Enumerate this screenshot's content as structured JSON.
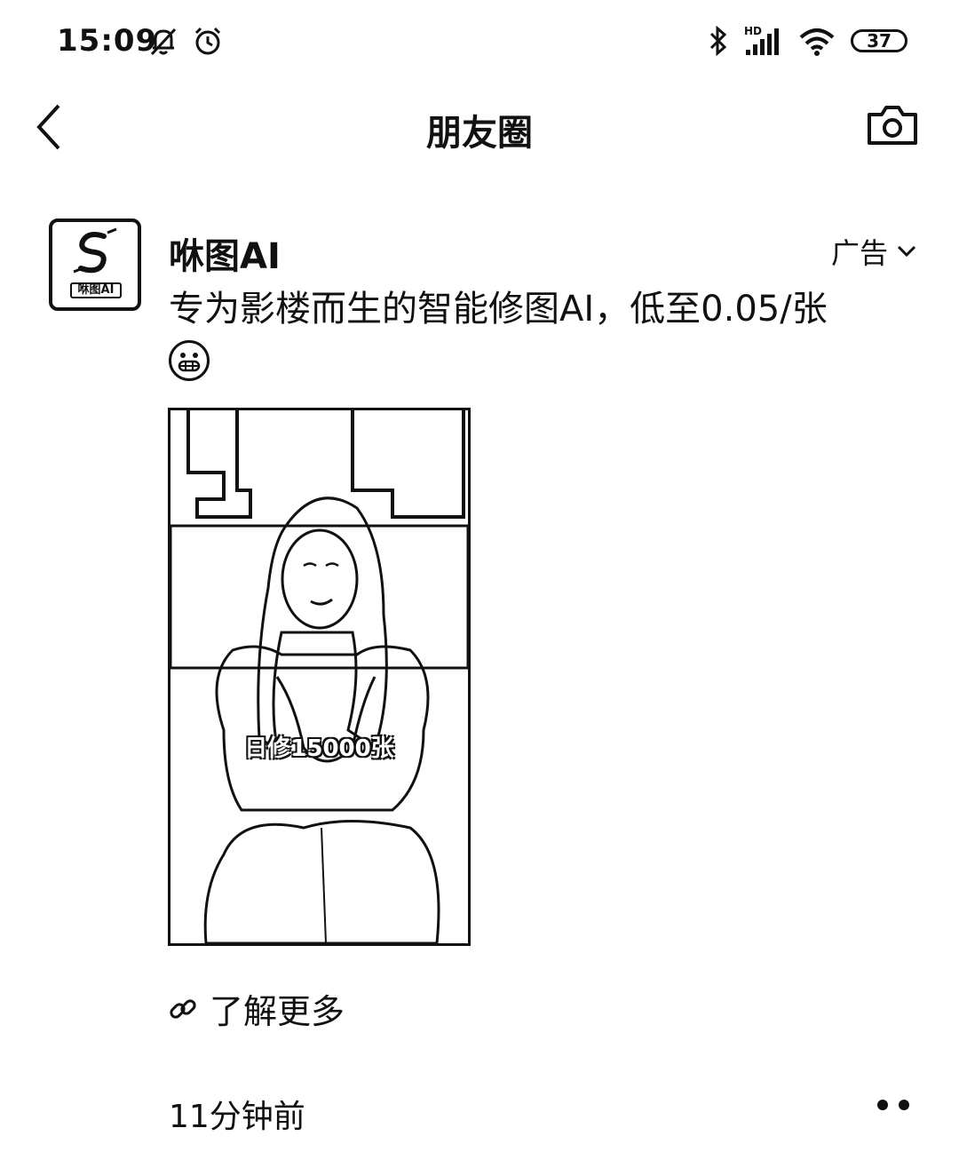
{
  "status_bar": {
    "time": "15:09",
    "icons": [
      "mute-bell-icon",
      "alarm-icon",
      "bluetooth-icon",
      "hd-signal-icon",
      "wifi-icon"
    ],
    "hd_label": "HD",
    "battery": "37"
  },
  "nav": {
    "back_icon": "chevron-left-icon",
    "title": "朋友圈",
    "camera_icon": "camera-icon"
  },
  "post": {
    "avatar_label": "咻图AI",
    "author": "咻图AI",
    "ad_label": "广告",
    "text": "专为影楼而生的智能修图AI，低至0.05/张",
    "emoji": "grinning-face-icon",
    "media_caption": "日修15000张",
    "learn_more": "了解更多",
    "link_icon": "link-icon",
    "timestamp": "11分钟前",
    "more_icon": "more-dots-icon"
  }
}
